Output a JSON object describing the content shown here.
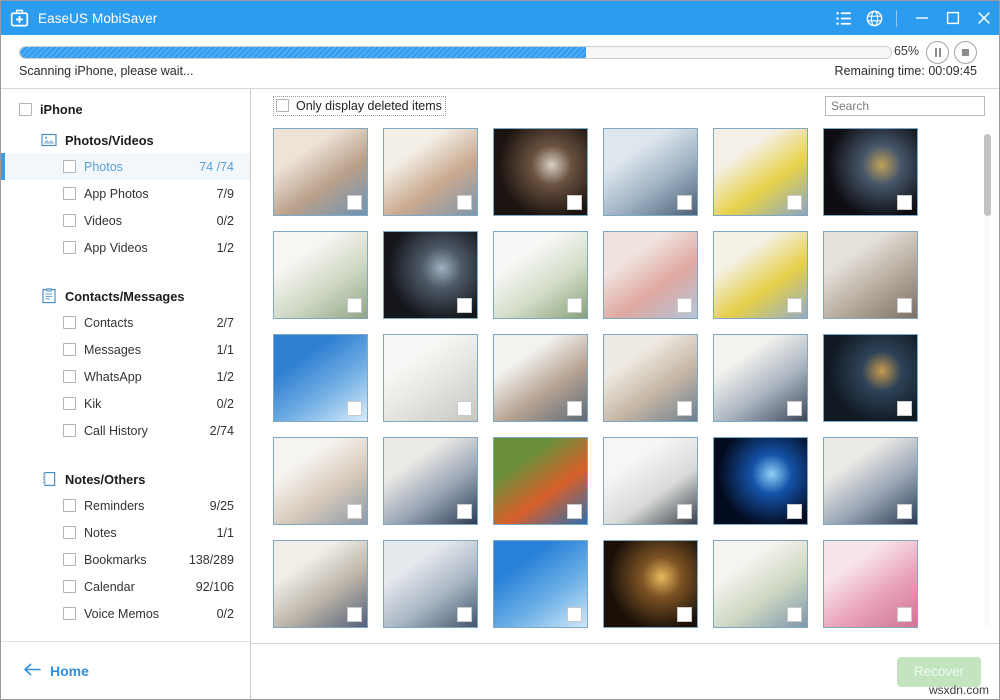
{
  "titlebar": {
    "app_title": "EaseUS MobiSaver",
    "logo_icon": "first-aid-kit-icon",
    "menu_icon": "list-menu-icon",
    "globe_icon": "globe-icon",
    "minimize_icon": "minimize-icon",
    "maximize_icon": "maximize-icon",
    "close_icon": "close-icon",
    "bg_color": "#2c9cf0"
  },
  "progress": {
    "percent_label": "65%",
    "percent_value": 65,
    "status_text": "Scanning iPhone, please wait...",
    "remaining_text": "Remaining time: 00:09:45",
    "pause_icon": "pause-icon",
    "stop_icon": "stop-icon",
    "fill_color": "#2f9cf2"
  },
  "sidebar": {
    "device": {
      "label": "iPhone"
    },
    "groups": [
      {
        "label": "Photos/Videos",
        "icon": "photo-icon",
        "items": [
          {
            "label": "Photos",
            "count": "74 /74",
            "selected": true
          },
          {
            "label": "App Photos",
            "count": "7/9",
            "selected": false
          },
          {
            "label": "Videos",
            "count": "0/2",
            "selected": false
          },
          {
            "label": "App Videos",
            "count": "1/2",
            "selected": false
          }
        ]
      },
      {
        "label": "Contacts/Messages",
        "icon": "contacts-icon",
        "items": [
          {
            "label": "Contacts",
            "count": "2/7",
            "selected": false
          },
          {
            "label": "Messages",
            "count": "1/1",
            "selected": false
          },
          {
            "label": "WhatsApp",
            "count": "1/2",
            "selected": false
          },
          {
            "label": "Kik",
            "count": "0/2",
            "selected": false
          },
          {
            "label": "Call History",
            "count": "2/74",
            "selected": false
          }
        ]
      },
      {
        "label": "Notes/Others",
        "icon": "notebook-icon",
        "items": [
          {
            "label": "Reminders",
            "count": "9/25",
            "selected": false
          },
          {
            "label": "Notes",
            "count": "1/1",
            "selected": false
          },
          {
            "label": "Bookmarks",
            "count": "138/289",
            "selected": false
          },
          {
            "label": "Calendar",
            "count": "92/106",
            "selected": false
          },
          {
            "label": "Voice Memos",
            "count": "0/2",
            "selected": false
          }
        ]
      }
    ],
    "home": {
      "label": "Home",
      "icon": "arrow-left-icon"
    },
    "accent_color": "#3f9ae0"
  },
  "toolbar": {
    "filter_label": "Only display deleted items",
    "filter_checked": false,
    "search_placeholder": "Search",
    "search_value": ""
  },
  "grid": {
    "thumbnails": [
      {
        "alt": "family at computer",
        "c1": "#efe3d8",
        "c2": "#b9a08a",
        "c3": "#6f93b5",
        "dark": false
      },
      {
        "alt": "people in bright office",
        "c1": "#f3efe6",
        "c2": "#caa98f",
        "c3": "#7d96ad",
        "dark": false
      },
      {
        "alt": "woman with mug in dark room",
        "c1": "#1b1410",
        "c2": "#6b5240",
        "c3": "#d8cfc4",
        "dark": true
      },
      {
        "alt": "man at desk with bookshelf",
        "c1": "#dfe7ee",
        "c2": "#9fb2c4",
        "c3": "#4b5f74",
        "dark": false
      },
      {
        "alt": "women with yellow tulips",
        "c1": "#f4f0e8",
        "c2": "#e8d24a",
        "c3": "#8aa6c0",
        "dark": false
      },
      {
        "alt": "man working at night city view",
        "c1": "#0e0d12",
        "c2": "#46566b",
        "c3": "#c2a15a",
        "dark": true
      },
      {
        "alt": "white living room with plant",
        "c1": "#f7f6f2",
        "c2": "#cfd8c4",
        "c3": "#8fa684",
        "dark": false
      },
      {
        "alt": "man at laptop dark window",
        "c1": "#14161b",
        "c2": "#4e5a68",
        "c3": "#9fb0c0",
        "dark": true
      },
      {
        "alt": "white sofa with plant",
        "c1": "#f8f8f6",
        "c2": "#d3ddc8",
        "c3": "#87a079",
        "dark": false
      },
      {
        "alt": "blurred bokeh lights",
        "c1": "#f1e4e0",
        "c2": "#dfa8a0",
        "c3": "#b5c4d8",
        "dark": false
      },
      {
        "alt": "woman with yellow flowers",
        "c1": "#f4f1e6",
        "c2": "#e6cf49",
        "c3": "#94adc4",
        "dark": false
      },
      {
        "alt": "wooden table top",
        "c1": "#e4e0da",
        "c2": "#b6aa9c",
        "c3": "#7c7065",
        "dark": false
      },
      {
        "alt": "blue sky with clouds",
        "c1": "#2f7fd2",
        "c2": "#71aee4",
        "c3": "#d8ecfa",
        "dark": false
      },
      {
        "alt": "bright empty room",
        "c1": "#f7f7f5",
        "c2": "#e2e2dd",
        "c3": "#c6c6bf",
        "dark": false
      },
      {
        "alt": "man with laptop",
        "c1": "#f2f2ee",
        "c2": "#b6a292",
        "c3": "#5d6a78",
        "dark": false
      },
      {
        "alt": "team meeting at table",
        "c1": "#efeae2",
        "c2": "#c5b6a4",
        "c3": "#6d7f90",
        "dark": false
      },
      {
        "alt": "businessmen at table",
        "c1": "#f2f2ee",
        "c2": "#aab4c0",
        "c3": "#3c4656",
        "dark": false
      },
      {
        "alt": "city at night from window",
        "c1": "#101822",
        "c2": "#2e4358",
        "c3": "#c79a4d",
        "dark": true
      },
      {
        "alt": "woman at white desk",
        "c1": "#f6f4f0",
        "c2": "#d7c9ba",
        "c3": "#8b9aa8",
        "dark": false
      },
      {
        "alt": "colleagues around monitor",
        "c1": "#eceae6",
        "c2": "#9aa6b6",
        "c3": "#2c3c55",
        "dark": false
      },
      {
        "alt": "woman with colorful umbrella",
        "c1": "#6a8f3a",
        "c2": "#d85f2a",
        "c3": "#2f6fb0",
        "dark": false
      },
      {
        "alt": "two people in bright hall",
        "c1": "#f6f6f4",
        "c2": "#d9dbd8",
        "c3": "#3a3f48",
        "dark": false
      },
      {
        "alt": "blue planet earth in space",
        "c1": "#030b1e",
        "c2": "#1452a8",
        "c3": "#8fd2f8",
        "dark": true
      },
      {
        "alt": "colleagues around monitor",
        "c1": "#eceae6",
        "c2": "#9aa6b6",
        "c3": "#2c3c55",
        "dark": false
      },
      {
        "alt": "business meeting in bright room",
        "c1": "#f1eee8",
        "c2": "#b9b2a6",
        "c3": "#53607a",
        "dark": false
      },
      {
        "alt": "man reading with bookshelf",
        "c1": "#e6e9ee",
        "c2": "#a9b6c4",
        "c3": "#43566c",
        "dark": false
      },
      {
        "alt": "blue sky",
        "c1": "#2a82d8",
        "c2": "#69aee6",
        "c3": "#cfe7f8",
        "dark": false
      },
      {
        "alt": "restaurant lights at night",
        "c1": "#1a1008",
        "c2": "#7d5324",
        "c3": "#e8b95c",
        "dark": true
      },
      {
        "alt": "mother and child with flowers",
        "c1": "#f6f4ef",
        "c2": "#cdd7c2",
        "c3": "#7e97ab",
        "dark": false
      },
      {
        "alt": "pink roses and greeting card",
        "c1": "#f8e4ea",
        "c2": "#e9a2bb",
        "c3": "#cf7593",
        "dark": false
      }
    ],
    "scrollbar": {
      "name": "vertical-scrollbar"
    }
  },
  "footer": {
    "recover_label": "Recover",
    "recover_enabled": false,
    "watermark": "wsxdn.com"
  }
}
